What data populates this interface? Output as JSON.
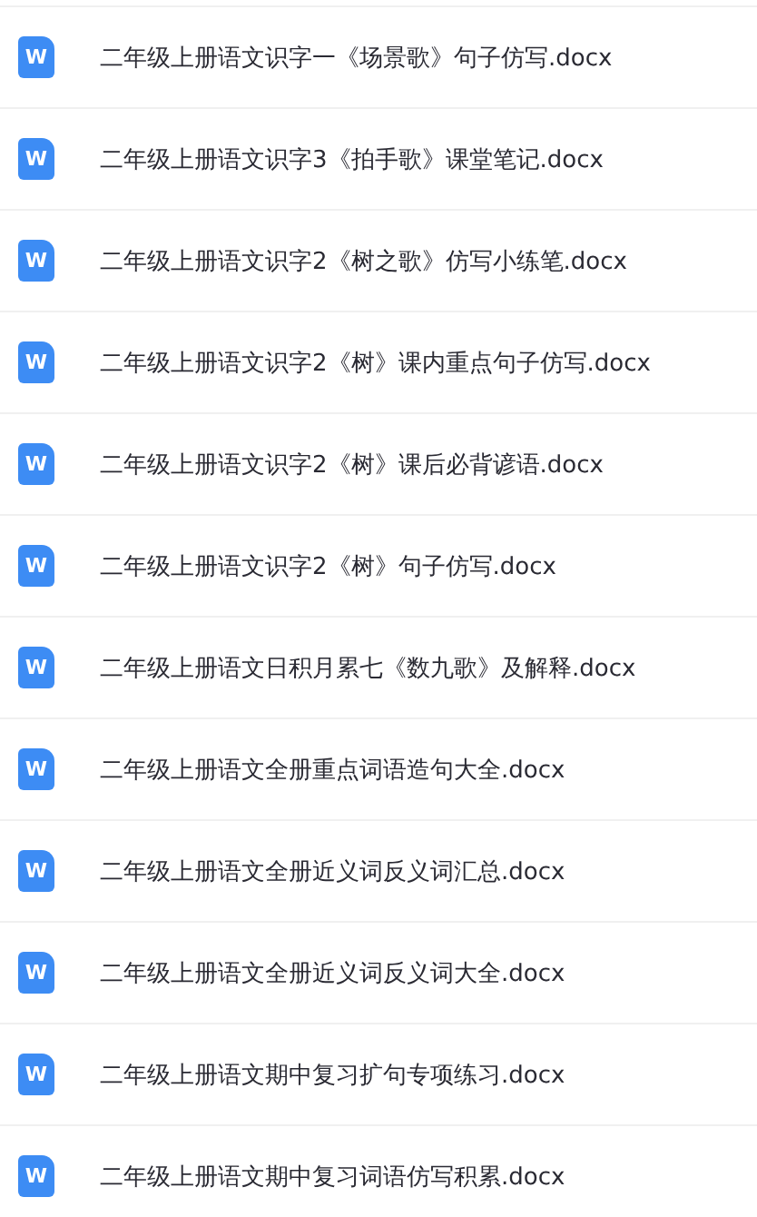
{
  "files": [
    {
      "icon_letter": "W",
      "name": "二年级上册语文识字一《场景歌》句子仿写.docx"
    },
    {
      "icon_letter": "W",
      "name": "二年级上册语文识字3《拍手歌》课堂笔记.docx"
    },
    {
      "icon_letter": "W",
      "name": "二年级上册语文识字2《树之歌》仿写小练笔.docx"
    },
    {
      "icon_letter": "W",
      "name": "二年级上册语文识字2《树》课内重点句子仿写.docx"
    },
    {
      "icon_letter": "W",
      "name": "二年级上册语文识字2《树》课后必背谚语.docx"
    },
    {
      "icon_letter": "W",
      "name": "二年级上册语文识字2《树》句子仿写.docx"
    },
    {
      "icon_letter": "W",
      "name": "二年级上册语文日积月累七《数九歌》及解释.docx"
    },
    {
      "icon_letter": "W",
      "name": "二年级上册语文全册重点词语造句大全.docx"
    },
    {
      "icon_letter": "W",
      "name": "二年级上册语文全册近义词反义词汇总.docx"
    },
    {
      "icon_letter": "W",
      "name": "二年级上册语文全册近义词反义词大全.docx"
    },
    {
      "icon_letter": "W",
      "name": "二年级上册语文期中复习扩句专项练习.docx"
    },
    {
      "icon_letter": "W",
      "name": "二年级上册语文期中复习词语仿写积累.docx"
    }
  ]
}
